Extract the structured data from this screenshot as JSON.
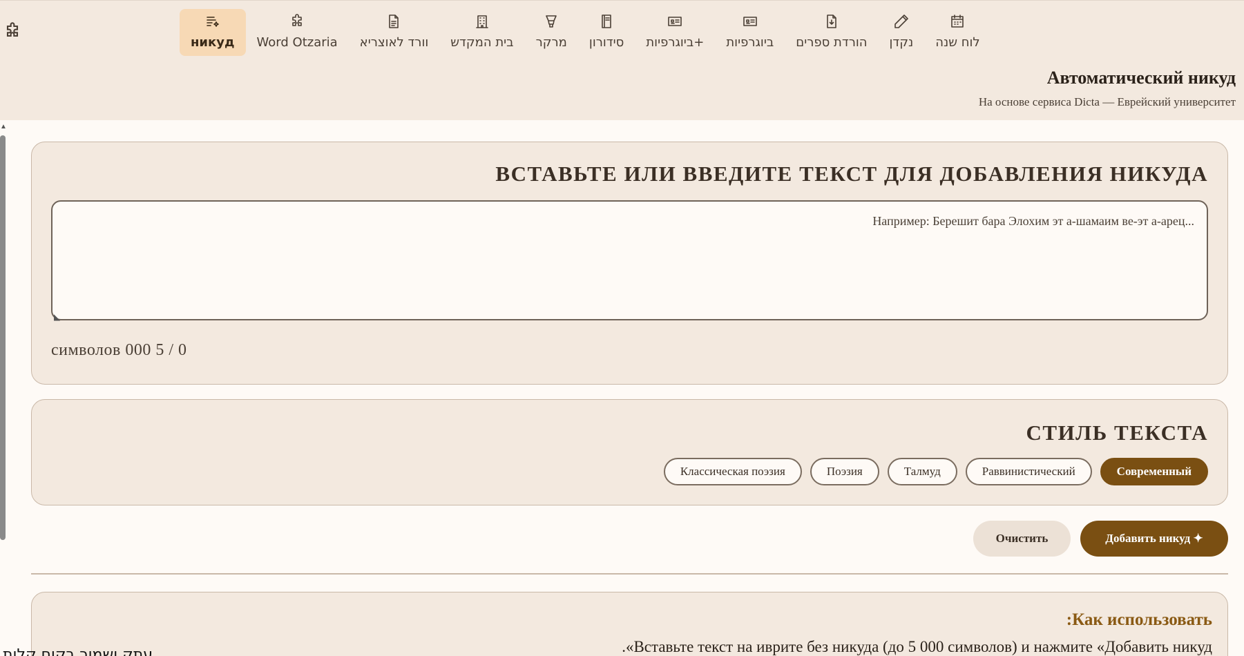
{
  "nav": {
    "items": [
      {
        "label": "никуд",
        "icon": "text-sparkle-icon",
        "active": true
      },
      {
        "label": "Word Otzaria",
        "icon": "puzzle-icon",
        "active": false
      },
      {
        "label": "וורד לאוצריא",
        "icon": "document-icon",
        "active": false
      },
      {
        "label": "בית המקדש",
        "icon": "building-icon",
        "active": false
      },
      {
        "label": "מרקר",
        "icon": "highlighter-icon",
        "active": false
      },
      {
        "label": "סידורון",
        "icon": "book-icon",
        "active": false
      },
      {
        "label": "ביוגרפיות+",
        "icon": "id-card-icon",
        "active": false
      },
      {
        "label": "ביוגרפיות",
        "icon": "id-card-icon",
        "active": false
      },
      {
        "label": "הורדת ספרים",
        "icon": "file-download-icon",
        "active": false
      },
      {
        "label": "נקדן",
        "icon": "pencil-icon",
        "active": false
      },
      {
        "label": "לוח שנה",
        "icon": "calendar-icon",
        "active": false
      }
    ]
  },
  "header": {
    "title": "Автоматический никуд",
    "subtitle": "На основе сервиса Dicta — Еврейский университет"
  },
  "input": {
    "section_title": "ВСТАВЬТЕ ИЛИ ВВЕДИТЕ ТЕКСТ ДЛЯ ДОБАВЛЕНИЯ НИКУДА",
    "placeholder": "...Например: Берешит бара Элохим эт а-шамаим ве-эт а-арец",
    "value": "",
    "counter": "символов 000 5 / 0"
  },
  "style": {
    "section_title": "СТИЛЬ ТЕКСТА",
    "options": [
      {
        "label": "Современный",
        "selected": true
      },
      {
        "label": "Раввинистический",
        "selected": false
      },
      {
        "label": "Талмуд",
        "selected": false
      },
      {
        "label": "Поэзия",
        "selected": false
      },
      {
        "label": "Классическая поэзия",
        "selected": false
      }
    ]
  },
  "actions": {
    "clear_label": "Очистить",
    "add_label": "Добавить никуд ✦"
  },
  "howto": {
    "title": ":Как использовать",
    "text": ".«Вставьте текст на иврите без никуда (до 5 000 символов) и нажмите «Добавить никуд"
  },
  "bottom_text": "עתק ושמור בקוח קלות",
  "colors": {
    "accent": "#7a4f12",
    "active_tab": "#f7d9b5",
    "panel": "#f3e9df",
    "background": "#fefaf6"
  }
}
